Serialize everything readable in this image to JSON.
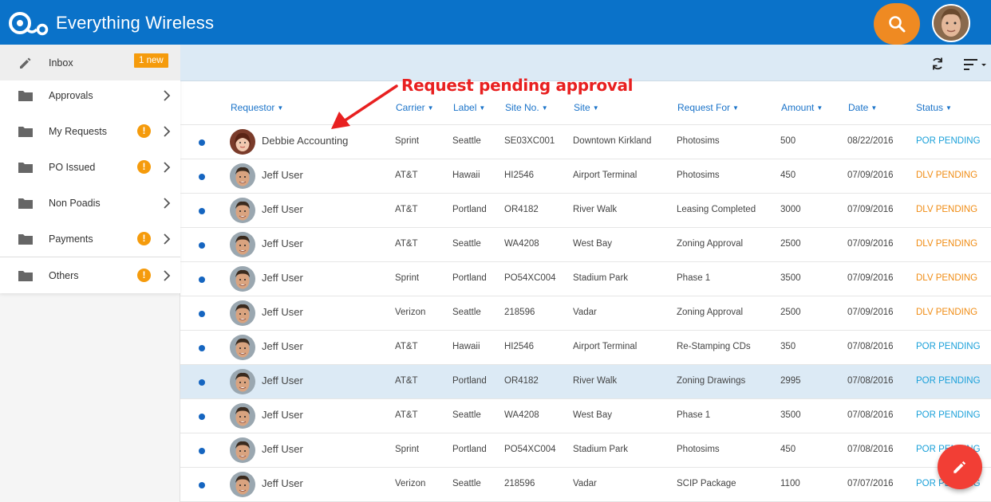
{
  "app": {
    "title": "Everything Wireless"
  },
  "sidebar": {
    "items": [
      {
        "label": "Inbox",
        "badge": "1 new"
      },
      {
        "label": "Approvals"
      },
      {
        "label": "My Requests",
        "alert": "!"
      },
      {
        "label": "PO Issued",
        "alert": "!"
      },
      {
        "label": "Non Poadis"
      },
      {
        "label": "Payments",
        "alert": "!"
      },
      {
        "label": "Others",
        "alert": "!"
      }
    ]
  },
  "table": {
    "columns": [
      "Requestor",
      "Carrier",
      "Label",
      "Site No.",
      "Site",
      "Request For",
      "Amount",
      "Date",
      "Status"
    ],
    "rows": [
      {
        "requestor": "Debbie Accounting",
        "carrier": "Sprint",
        "label": "Seattle",
        "site_no": "SE03XC001",
        "site": "Downtown Kirkland",
        "request_for": "Photosims",
        "amount": "500",
        "date": "08/22/2016",
        "status": "POR PENDING"
      },
      {
        "requestor": "Jeff User",
        "carrier": "AT&T",
        "label": "Hawaii",
        "site_no": "HI2546",
        "site": "Airport Terminal",
        "request_for": "Photosims",
        "amount": "450",
        "date": "07/09/2016",
        "status": "DLV PENDING"
      },
      {
        "requestor": "Jeff User",
        "carrier": "AT&T",
        "label": "Portland",
        "site_no": "OR4182",
        "site": "River Walk",
        "request_for": "Leasing Completed",
        "amount": "3000",
        "date": "07/09/2016",
        "status": "DLV PENDING"
      },
      {
        "requestor": "Jeff User",
        "carrier": "AT&T",
        "label": "Seattle",
        "site_no": "WA4208",
        "site": "West Bay",
        "request_for": "Zoning Approval",
        "amount": "2500",
        "date": "07/09/2016",
        "status": "DLV PENDING"
      },
      {
        "requestor": "Jeff User",
        "carrier": "Sprint",
        "label": "Portland",
        "site_no": "PO54XC004",
        "site": "Stadium Park",
        "request_for": "Phase 1",
        "amount": "3500",
        "date": "07/09/2016",
        "status": "DLV PENDING"
      },
      {
        "requestor": "Jeff User",
        "carrier": "Verizon",
        "label": "Seattle",
        "site_no": "218596",
        "site": "Vadar",
        "request_for": "Zoning Approval",
        "amount": "2500",
        "date": "07/09/2016",
        "status": "DLV PENDING"
      },
      {
        "requestor": "Jeff User",
        "carrier": "AT&T",
        "label": "Hawaii",
        "site_no": "HI2546",
        "site": "Airport Terminal",
        "request_for": "Re-Stamping CDs",
        "amount": "350",
        "date": "07/08/2016",
        "status": "POR PENDING"
      },
      {
        "requestor": "Jeff User",
        "carrier": "AT&T",
        "label": "Portland",
        "site_no": "OR4182",
        "site": "River Walk",
        "request_for": "Zoning Drawings",
        "amount": "2995",
        "date": "07/08/2016",
        "status": "POR PENDING"
      },
      {
        "requestor": "Jeff User",
        "carrier": "AT&T",
        "label": "Seattle",
        "site_no": "WA4208",
        "site": "West Bay",
        "request_for": "Phase 1",
        "amount": "3500",
        "date": "07/08/2016",
        "status": "POR PENDING"
      },
      {
        "requestor": "Jeff User",
        "carrier": "Sprint",
        "label": "Portland",
        "site_no": "PO54XC004",
        "site": "Stadium Park",
        "request_for": "Photosims",
        "amount": "450",
        "date": "07/08/2016",
        "status": "POR PENDING"
      },
      {
        "requestor": "Jeff User",
        "carrier": "Verizon",
        "label": "Seattle",
        "site_no": "218596",
        "site": "Vadar",
        "request_for": "SCIP Package",
        "amount": "1100",
        "date": "07/07/2016",
        "status": "POR PENDING"
      }
    ]
  },
  "annotation": {
    "text": "Request pending approval"
  },
  "colors": {
    "brand": "#0a72c9",
    "search": "#ef8a22",
    "fab": "#f23e35",
    "por_status": "#1aa0d9",
    "dlv_status": "#f08c14",
    "badge": "#f59b0c"
  }
}
